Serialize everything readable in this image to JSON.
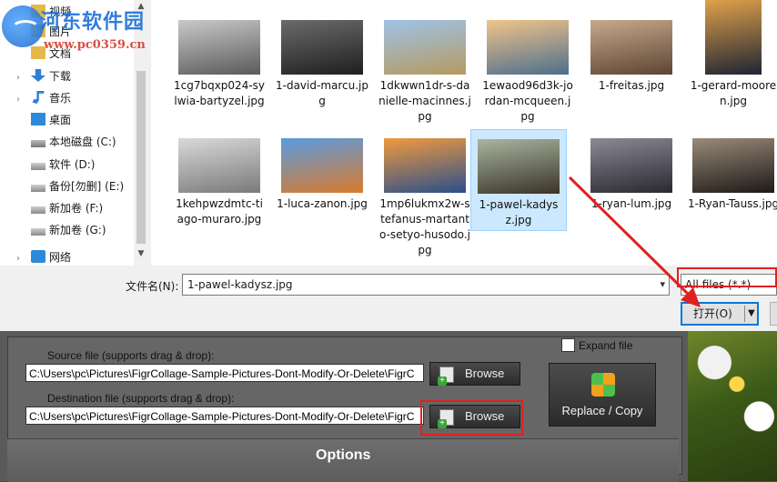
{
  "watermark": {
    "title": "河东软件园",
    "url": "www.pc0359.cn"
  },
  "nav": {
    "items": [
      {
        "label": "视频",
        "icon": "video-folder-icon"
      },
      {
        "label": "图片",
        "icon": "pictures-folder-icon"
      },
      {
        "label": "文档",
        "icon": "documents-folder-icon"
      },
      {
        "label": "下载",
        "icon": "download-icon"
      },
      {
        "label": "音乐",
        "icon": "music-icon"
      },
      {
        "label": "桌面",
        "icon": "desktop-icon"
      },
      {
        "label": "本地磁盘 (C:)",
        "icon": "local-disk-icon"
      },
      {
        "label": "软件 (D:)",
        "icon": "drive-icon"
      },
      {
        "label": "备份[勿删] (E:)",
        "icon": "drive-icon"
      },
      {
        "label": "新加卷 (F:)",
        "icon": "drive-icon"
      },
      {
        "label": "新加卷 (G:)",
        "icon": "drive-icon"
      },
      {
        "label": "网络",
        "icon": "network-icon"
      }
    ]
  },
  "files": [
    {
      "name": "1cg7bqxp024-sylwia-bartyzel.jpg",
      "colors": [
        "#c9c9c9",
        "#5a5a5a"
      ]
    },
    {
      "name": "1-david-marcu.jpg",
      "colors": [
        "#6b6b6b",
        "#1f1f1f"
      ]
    },
    {
      "name": "1dkwwn1dr-s-danielle-macinnes.jpg",
      "colors": [
        "#9ec3e6",
        "#b59a62"
      ]
    },
    {
      "name": "1ewaod96d3k-jordan-mcqueen.jpg",
      "colors": [
        "#f0c48a",
        "#4d6f8c"
      ]
    },
    {
      "name": "1-freitas.jpg",
      "colors": [
        "#c7a98c",
        "#5d4534"
      ]
    },
    {
      "name": "1-gerard-mooren.jpg",
      "colors": [
        "#e0a04a",
        "#1e2533"
      ]
    },
    {
      "name": "1kehpwzdmtc-tiago-muraro.jpg",
      "colors": [
        "#d9d9d9",
        "#7a7a7a"
      ]
    },
    {
      "name": "1-luca-zanon.jpg",
      "colors": [
        "#5a9be0",
        "#d97a2c"
      ]
    },
    {
      "name": "1mp6lukmx2w-stefanus-martanto-setyo-husodo.jpg",
      "colors": [
        "#f09a3e",
        "#2b4f8a"
      ]
    },
    {
      "name": "1-pawel-kadysz.jpg",
      "colors": [
        "#a8b5a0",
        "#3a3328"
      ]
    },
    {
      "name": "1-ryan-lum.jpg",
      "colors": [
        "#8a8a96",
        "#2a2830"
      ]
    },
    {
      "name": "1-Ryan-Tauss.jpg",
      "colors": [
        "#9a8a7a",
        "#1e1a17"
      ]
    }
  ],
  "selected_file": "1-pawel-kadysz.jpg",
  "dialog": {
    "filename_label": "文件名(N):",
    "filename_value": "1-pawel-kadysz.jpg",
    "filetype_value": "All files (*.*)",
    "open_label": "打开(O)"
  },
  "app": {
    "source_label": "Source file (supports drag & drop):",
    "source_path": "C:\\Users\\pc\\Pictures\\FigrCollage-Sample-Pictures-Dont-Modify-Or-Delete\\FigrC",
    "dest_label": "Destination file (supports drag & drop):",
    "dest_path": "C:\\Users\\pc\\Pictures\\FigrCollage-Sample-Pictures-Dont-Modify-Or-Delete\\FigrC",
    "browse_label": "Browse",
    "expand_label": "Expand file",
    "replace_label": "Replace / Copy",
    "options_label": "Options"
  },
  "colors": {
    "accent": "#0078d7",
    "highlight": "#e02020"
  }
}
